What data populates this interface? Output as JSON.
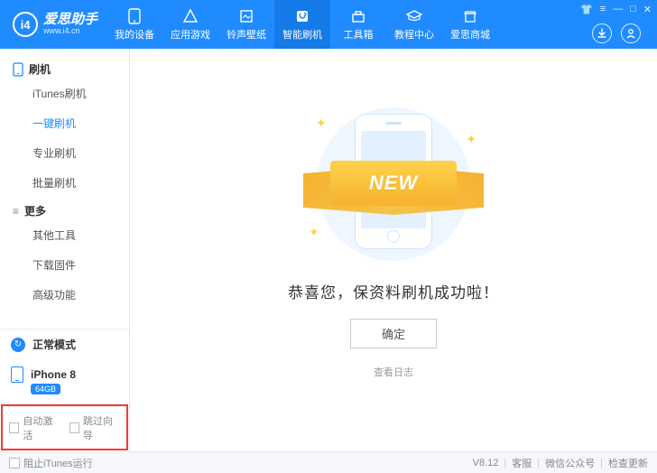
{
  "header": {
    "brand": "爱思助手",
    "url": "www.i4.cn",
    "nav": [
      {
        "label": "我的设备"
      },
      {
        "label": "应用游戏"
      },
      {
        "label": "铃声壁纸"
      },
      {
        "label": "智能刷机",
        "active": true
      },
      {
        "label": "工具箱"
      },
      {
        "label": "教程中心"
      },
      {
        "label": "爱思商城"
      }
    ]
  },
  "sidebar": {
    "groups": [
      {
        "title": "刷机",
        "items": [
          {
            "label": "iTunes刷机"
          },
          {
            "label": "一键刷机",
            "active": true
          },
          {
            "label": "专业刷机"
          },
          {
            "label": "批量刷机"
          }
        ]
      },
      {
        "title": "更多",
        "items": [
          {
            "label": "其他工具"
          },
          {
            "label": "下载固件"
          },
          {
            "label": "高级功能"
          }
        ]
      }
    ],
    "mode": "正常模式",
    "device": "iPhone 8",
    "storage": "64GB",
    "auto_activate": "自动激活",
    "skip_guide": "跳过向导"
  },
  "main": {
    "ribbon": "NEW",
    "congrats": "恭喜您，保资料刷机成功啦！",
    "confirm": "确定",
    "view_log": "查看日志"
  },
  "footer": {
    "block_itunes": "阻止iTunes运行",
    "version": "V8.12",
    "support": "客服",
    "wechat": "微信公众号",
    "check_update": "检查更新"
  }
}
